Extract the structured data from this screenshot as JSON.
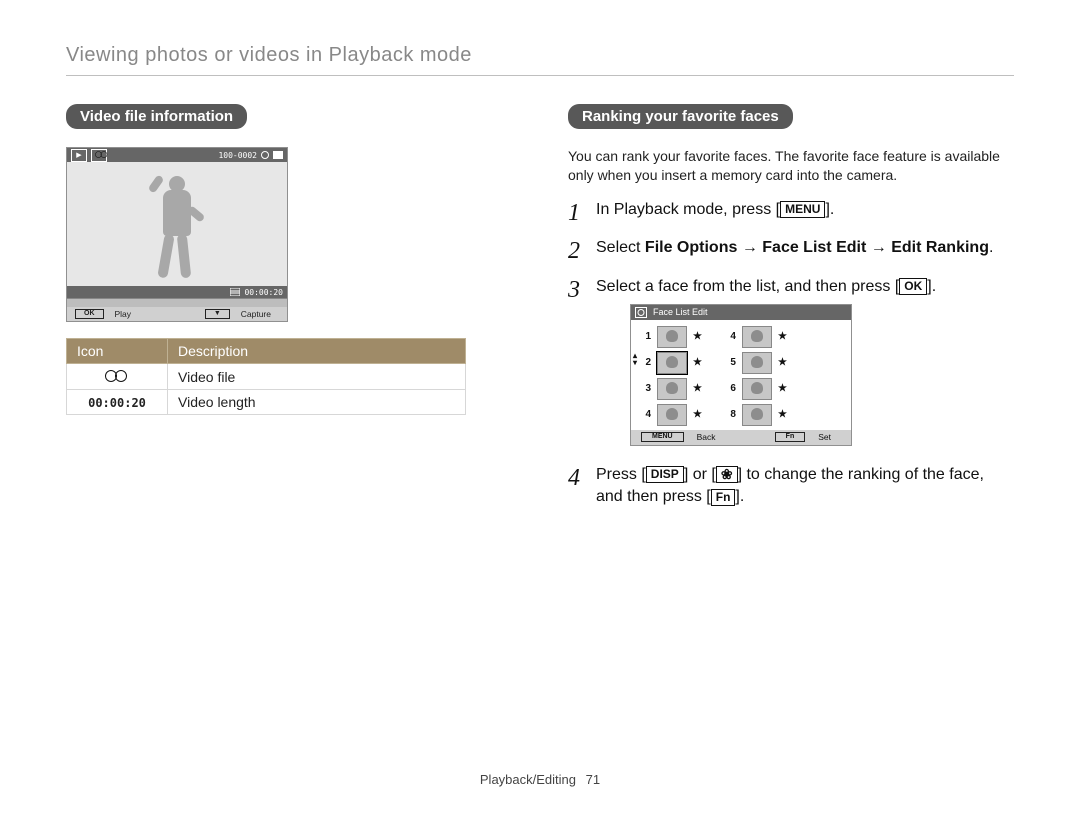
{
  "header": "Viewing photos or videos in Playback mode",
  "footer": {
    "section": "Playback/Editing",
    "page": "71"
  },
  "left": {
    "pill": "Video file information",
    "camera_screen": {
      "file_counter": "100-0002",
      "elapsed": "00:00:20",
      "ctrl_ok_key": "OK",
      "ctrl_play": "Play",
      "ctrl_down_key": "▼",
      "ctrl_capture": "Capture"
    },
    "table": {
      "head_icon": "Icon",
      "head_desc": "Description",
      "rows": [
        {
          "icon_name": "camcorder-icon",
          "icon_text": "",
          "desc": "Video file"
        },
        {
          "icon_name": "video-length-icon",
          "icon_text": "00:00:20",
          "desc": "Video length"
        }
      ]
    }
  },
  "right": {
    "pill": "Ranking your favorite faces",
    "intro": "You can rank your favorite faces. The favorite face feature is available only when you insert a memory card into the camera.",
    "steps": {
      "s1_pre": "In Playback mode, press [",
      "s1_key": "MENU",
      "s1_post": "].",
      "s2_pre": "Select ",
      "s2_b1": "File Options",
      "s2_arrow": " → ",
      "s2_b2": "Face List Edit",
      "s2_b3": "Edit Ranking",
      "s2_post": ".",
      "s3_pre": "Select a face from the list, and then press [",
      "s3_key": "OK",
      "s3_post": "].",
      "s4_pre": "Press [",
      "s4_k1": "DISP",
      "s4_or": "] or [",
      "s4_k2": "❀",
      "s4_mid": "] to change the ranking of the face, and then press [",
      "s4_k3": "Fn",
      "s4_post": "]."
    },
    "face_screen": {
      "title": "Face List Edit",
      "left_nums": [
        "1",
        "2",
        "3",
        "4"
      ],
      "right_nums": [
        "4",
        "5",
        "6",
        "8"
      ],
      "back_key": "MENU",
      "back_label": "Back",
      "set_key": "Fn",
      "set_label": "Set"
    }
  }
}
